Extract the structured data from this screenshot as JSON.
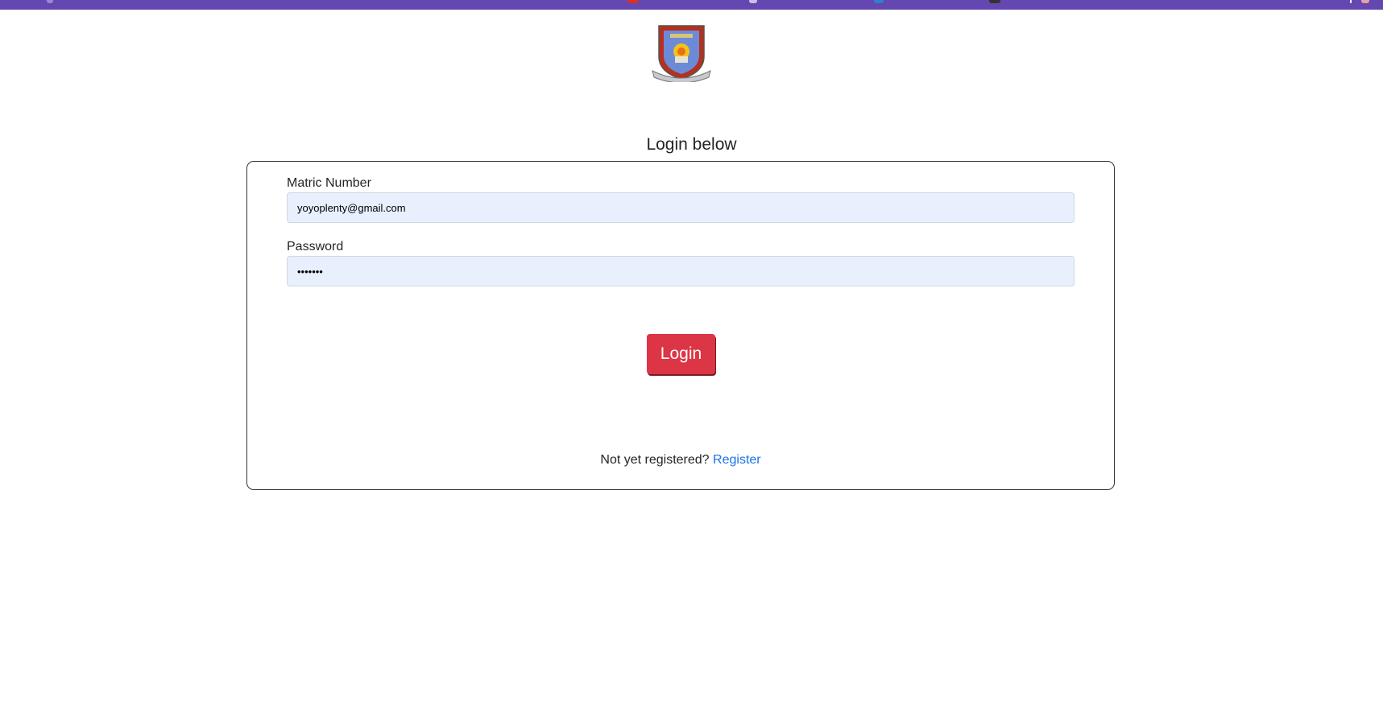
{
  "window": {
    "accent_color": "#6447b0"
  },
  "logo": {
    "name": "institution-crest"
  },
  "heading": "Login below",
  "form": {
    "matric_label": "Matric Number",
    "matric_value": "yoyoplenty@gmail.com",
    "password_label": "Password",
    "password_value": "1234567",
    "login_button": "Login",
    "login_button_color": "#dc3545"
  },
  "footer": {
    "prompt": "Not yet registered?",
    "register_link": "Register",
    "link_color": "#1a73e8"
  }
}
